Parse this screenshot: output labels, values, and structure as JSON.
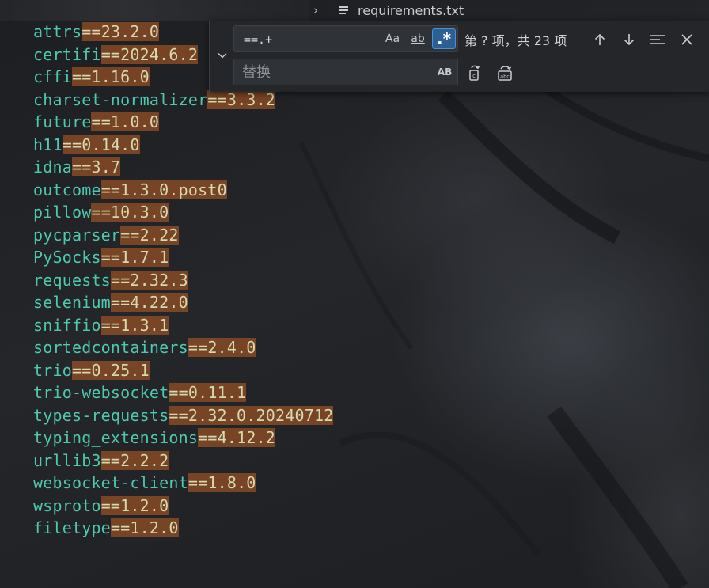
{
  "breadcrumb": {
    "separator": "›",
    "file_name": "requirements.txt"
  },
  "editor": {
    "lines": [
      {
        "pkg": "attrs",
        "ver": "==23.2.0"
      },
      {
        "pkg": "certifi",
        "ver": "==2024.6.2"
      },
      {
        "pkg": "cffi",
        "ver": "==1.16.0"
      },
      {
        "pkg": "charset-normalizer",
        "ver": "==3.3.2"
      },
      {
        "pkg": "future",
        "ver": "==1.0.0"
      },
      {
        "pkg": "h11",
        "ver": "==0.14.0"
      },
      {
        "pkg": "idna",
        "ver": "==3.7"
      },
      {
        "pkg": "outcome",
        "ver": "==1.3.0.post0"
      },
      {
        "pkg": "pillow",
        "ver": "==10.3.0"
      },
      {
        "pkg": "pycparser",
        "ver": "==2.22"
      },
      {
        "pkg": "PySocks",
        "ver": "==1.7.1"
      },
      {
        "pkg": "requests",
        "ver": "==2.32.3"
      },
      {
        "pkg": "selenium",
        "ver": "==4.22.0"
      },
      {
        "pkg": "sniffio",
        "ver": "==1.3.1"
      },
      {
        "pkg": "sortedcontainers",
        "ver": "==2.4.0"
      },
      {
        "pkg": "trio",
        "ver": "==0.25.1"
      },
      {
        "pkg": "trio-websocket",
        "ver": "==0.11.1"
      },
      {
        "pkg": "types-requests",
        "ver": "==2.32.0.20240712"
      },
      {
        "pkg": "typing_extensions",
        "ver": "==4.12.2"
      },
      {
        "pkg": "urllib3",
        "ver": "==2.2.2"
      },
      {
        "pkg": "websocket-client",
        "ver": "==1.8.0"
      },
      {
        "pkg": "wsproto",
        "ver": "==1.2.0"
      },
      {
        "pkg": "filetype",
        "ver": "==1.2.0"
      }
    ]
  },
  "find_widget": {
    "find_value": "==.+",
    "replace_placeholder": "替换",
    "match_case_label": "Aa",
    "whole_word_label": "ab",
    "regex_label": ".*",
    "preserve_case_label": "AB",
    "match_count": "第 ? 项，共 23 项",
    "regex_active": true,
    "colors": {
      "regex_active_bg": "#2c5f94",
      "match_highlight": "#985226",
      "package_name": "#4ec9b0"
    },
    "icons": {
      "toggle": "chevron-down-icon",
      "prev": "arrow-up-icon",
      "next": "arrow-down-icon",
      "selection": "find-in-selection-icon",
      "close": "close-icon",
      "replace_one": "replace-icon",
      "replace_all": "replace-all-icon"
    }
  }
}
